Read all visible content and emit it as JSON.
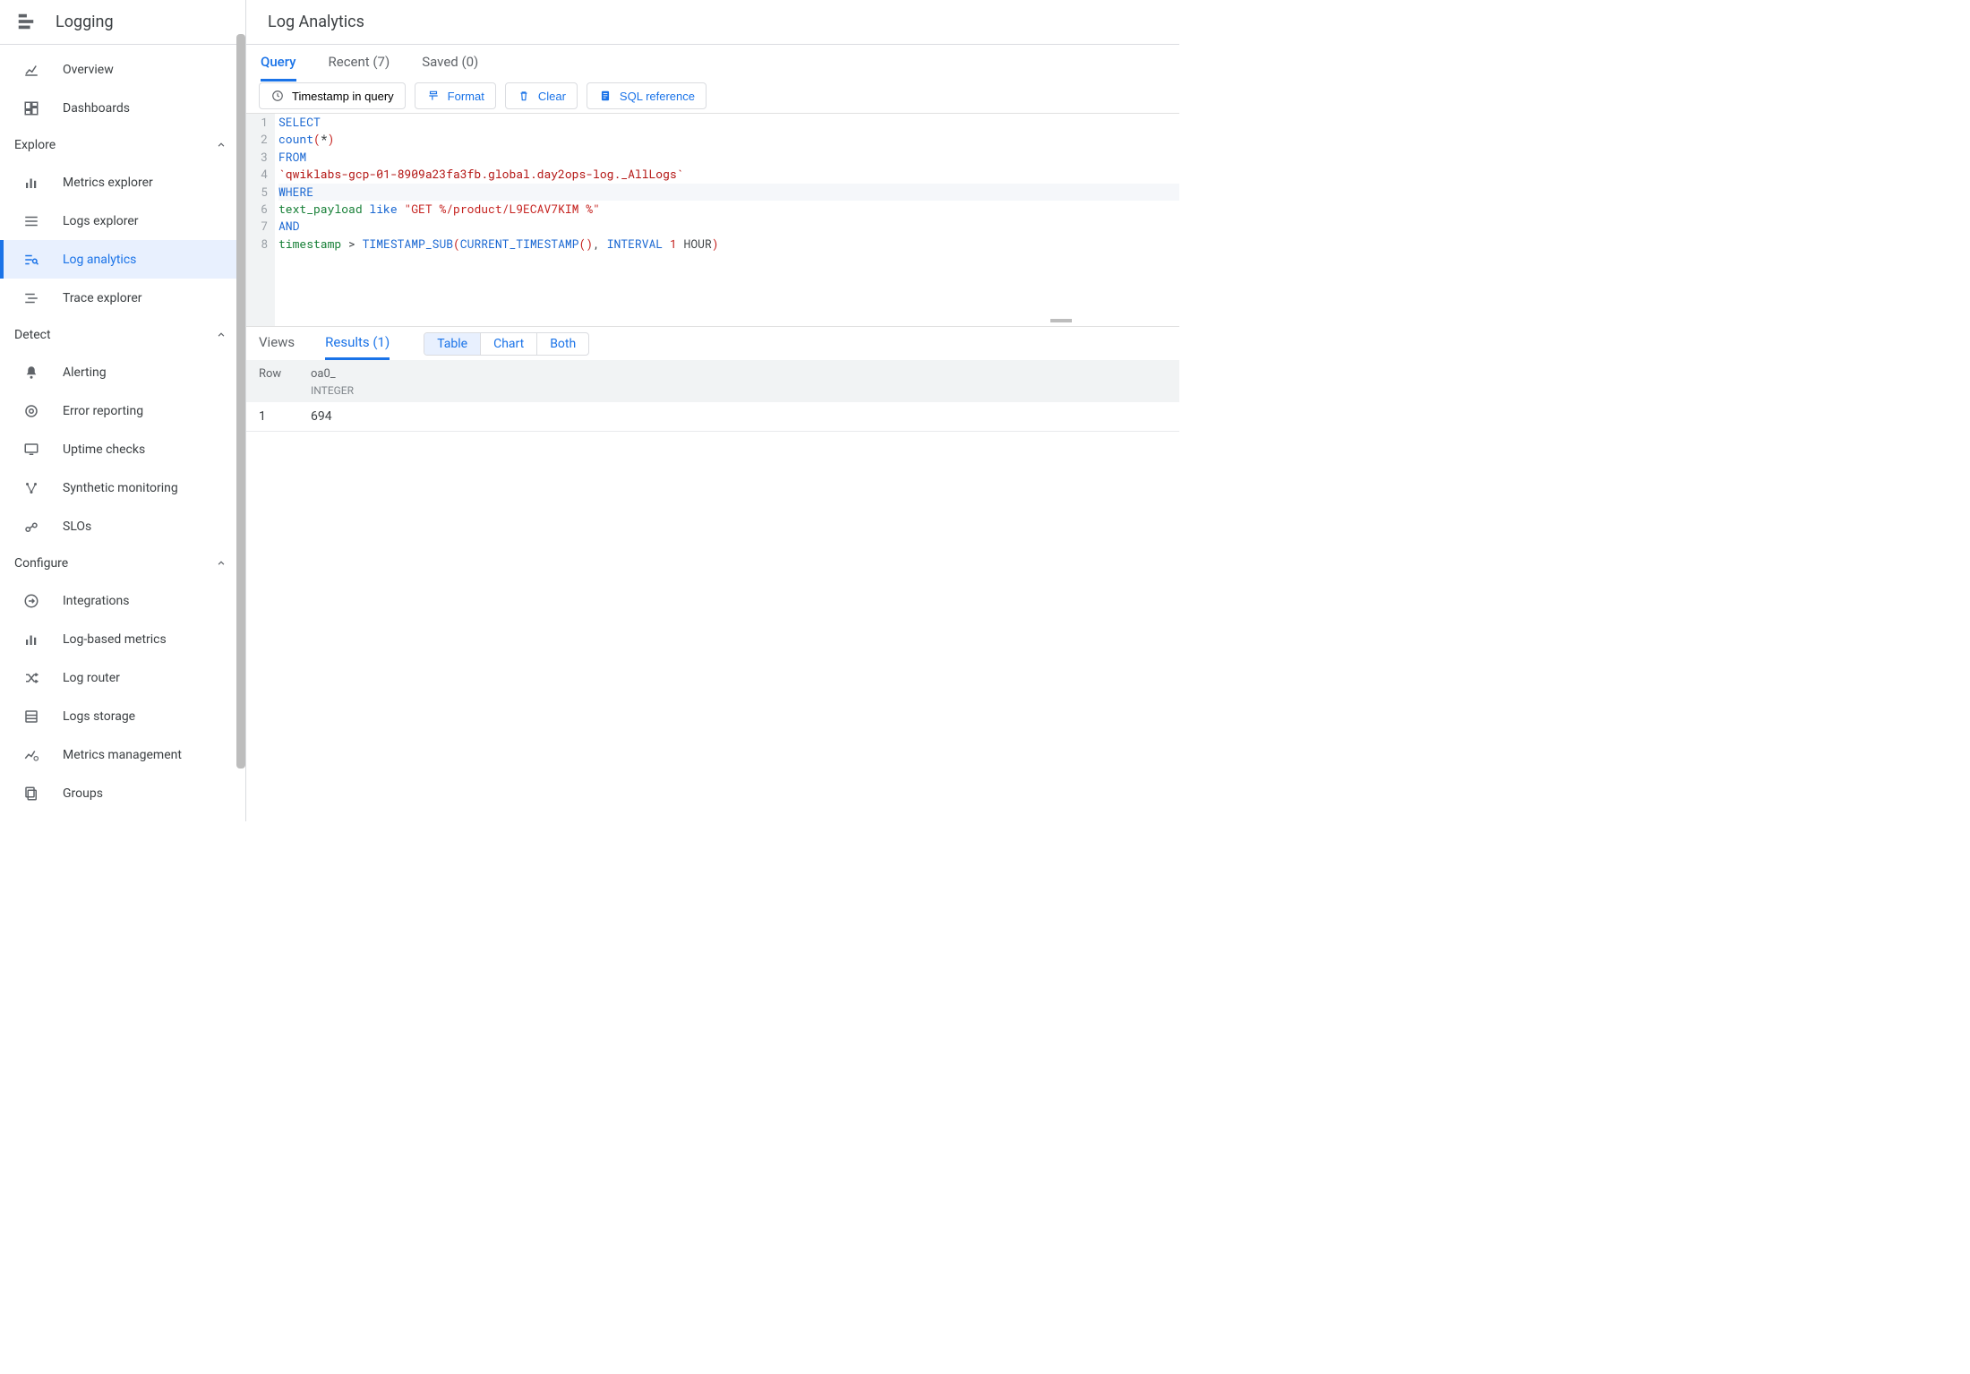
{
  "sidebar": {
    "title": "Logging",
    "groups": [
      {
        "items": [
          {
            "label": "Overview",
            "icon": "analytics-icon",
            "id": "overview"
          },
          {
            "label": "Dashboards",
            "icon": "dashboard-icon",
            "id": "dashboards"
          }
        ]
      }
    ],
    "sections": [
      {
        "name": "Explore",
        "items": [
          {
            "label": "Metrics explorer",
            "icon": "bar-icon",
            "id": "metrics-explorer"
          },
          {
            "label": "Logs explorer",
            "icon": "lines-icon",
            "id": "logs-explorer"
          },
          {
            "label": "Log analytics",
            "icon": "search-lines-icon",
            "id": "log-analytics",
            "active": true
          },
          {
            "label": "Trace explorer",
            "icon": "indent-icon",
            "id": "trace-explorer"
          }
        ]
      },
      {
        "name": "Detect",
        "items": [
          {
            "label": "Alerting",
            "icon": "bell-icon",
            "id": "alerting"
          },
          {
            "label": "Error reporting",
            "icon": "target-icon",
            "id": "error-reporting"
          },
          {
            "label": "Uptime checks",
            "icon": "monitor-icon",
            "id": "uptime-checks"
          },
          {
            "label": "Synthetic monitoring",
            "icon": "nodes-icon",
            "id": "synthetic-monitoring"
          },
          {
            "label": "SLOs",
            "icon": "gauge-icon",
            "id": "slos"
          }
        ]
      },
      {
        "name": "Configure",
        "items": [
          {
            "label": "Integrations",
            "icon": "arrow-in-icon",
            "id": "integrations"
          },
          {
            "label": "Log-based metrics",
            "icon": "bar-icon",
            "id": "log-based-metrics"
          },
          {
            "label": "Log router",
            "icon": "shuffle-icon",
            "id": "log-router"
          },
          {
            "label": "Logs storage",
            "icon": "storage-icon",
            "id": "logs-storage"
          },
          {
            "label": "Metrics management",
            "icon": "trend-gear-icon",
            "id": "metrics-management"
          },
          {
            "label": "Groups",
            "icon": "copy-icon",
            "id": "groups"
          }
        ]
      }
    ]
  },
  "header": {
    "title": "Log Analytics"
  },
  "tabs": [
    {
      "label": "Query",
      "active": true
    },
    {
      "label": "Recent (7)"
    },
    {
      "label": "Saved (0)"
    }
  ],
  "toolbar": {
    "timestamp": "Timestamp in query",
    "format": "Format",
    "clear": "Clear",
    "sqlref": "SQL reference"
  },
  "code": [
    [
      {
        "t": "SELECT",
        "c": "kw"
      }
    ],
    [
      {
        "t": "count",
        "c": "func"
      },
      {
        "t": "(",
        "c": "punc"
      },
      {
        "t": "*",
        "c": "op"
      },
      {
        "t": ")",
        "c": "punc"
      }
    ],
    [
      {
        "t": "FROM",
        "c": "kw"
      }
    ],
    [
      {
        "t": "`qwiklabs-gcp-01-8909a23fa3fb.global.day2ops-log._AllLogs`",
        "c": "table"
      }
    ],
    [
      {
        "t": "WHERE",
        "c": "kw"
      }
    ],
    [
      {
        "t": "text_payload ",
        "c": "id"
      },
      {
        "t": "like ",
        "c": "kw"
      },
      {
        "t": "\"GET %/product/L9ECAV7KIM %\"",
        "c": "str"
      }
    ],
    [
      {
        "t": "AND",
        "c": "kw"
      }
    ],
    [
      {
        "t": "timestamp ",
        "c": "id"
      },
      {
        "t": "> ",
        "c": "op"
      },
      {
        "t": "TIMESTAMP_SUB",
        "c": "func"
      },
      {
        "t": "(",
        "c": "punc"
      },
      {
        "t": "CURRENT_TIMESTAMP",
        "c": "func"
      },
      {
        "t": "()",
        "c": "punc"
      },
      {
        "t": ", ",
        "c": "op"
      },
      {
        "t": "INTERVAL ",
        "c": "kw"
      },
      {
        "t": "1",
        "c": "num"
      },
      {
        "t": " HOUR",
        "c": "op"
      },
      {
        "t": ")",
        "c": "punc"
      }
    ]
  ],
  "code_selected_line": 5,
  "results": {
    "tabs": [
      {
        "label": "Views"
      },
      {
        "label": "Results (1)",
        "active": true
      }
    ],
    "segments": [
      {
        "label": "Table",
        "active": true
      },
      {
        "label": "Chart"
      },
      {
        "label": "Both"
      }
    ],
    "columns": [
      {
        "name": "Row"
      },
      {
        "name": "oa0_",
        "type": "INTEGER"
      }
    ],
    "rows": [
      {
        "row": "1",
        "val": "694"
      }
    ]
  }
}
